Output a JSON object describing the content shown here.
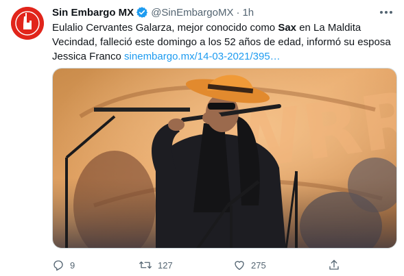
{
  "tweet": {
    "display_name": "Sin Embargo MX",
    "handle": "@SinEmbargoMX",
    "separator": "·",
    "time": "1h",
    "text_pre": "Eulalio Cervantes Galarza, mejor conocido como ",
    "text_bold": "Sax",
    "text_mid": " en La Maldita Vecindad, falleció este domingo a los 52 años de edad, informó su esposa Jessica Franco ",
    "link": "sinembargo.mx/14-03-2021/395…",
    "media": {
      "sign_letters": "WRRD"
    }
  },
  "actions": {
    "reply_count": "9",
    "retweet_count": "127",
    "like_count": "275"
  },
  "icons": {
    "avatar": "sin-embargo-logo",
    "verified": "verified-badge-icon",
    "more": "more-dots-icon",
    "reply": "reply-icon",
    "retweet": "retweet-icon",
    "like": "heart-icon",
    "share": "share-icon"
  },
  "colors": {
    "brand_red": "#e1251b",
    "link_blue": "#1d9bf0",
    "muted_gray": "#536471"
  }
}
